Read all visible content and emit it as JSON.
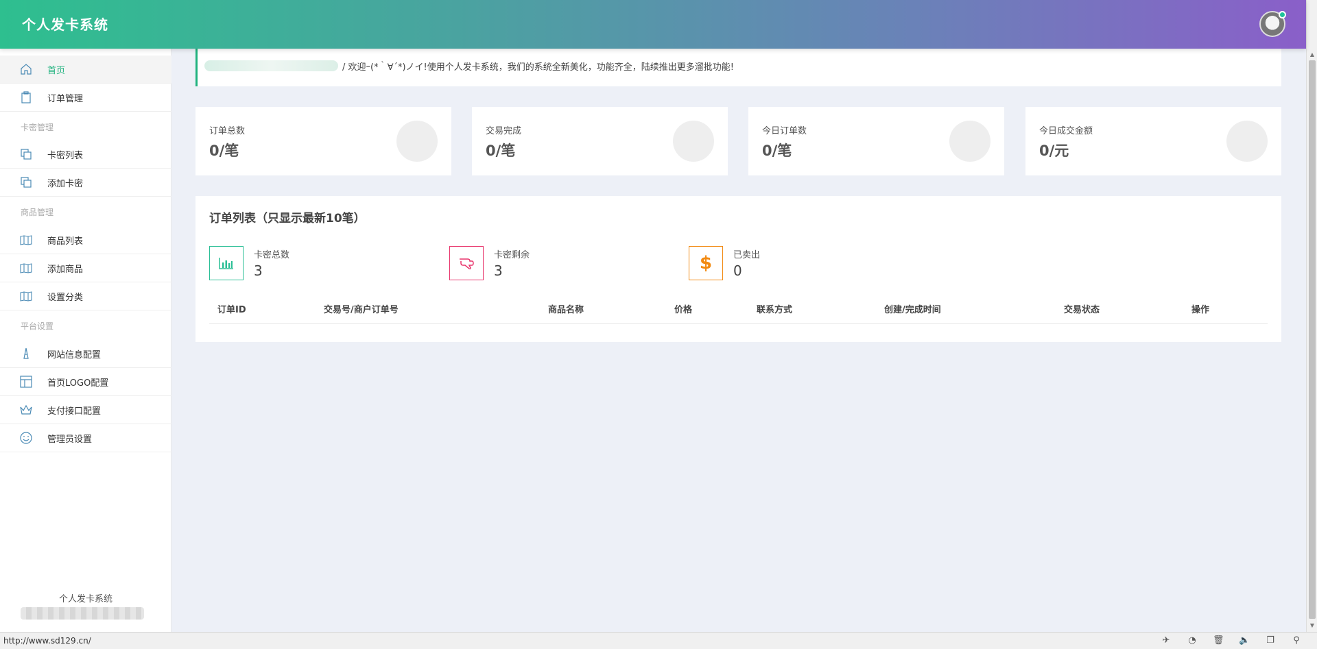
{
  "header": {
    "brand": "个人发卡系统"
  },
  "sidebar": {
    "items": [
      {
        "label": "首页",
        "icon": "home-icon"
      },
      {
        "label": "订单管理",
        "icon": "clipboard-icon"
      },
      {
        "group": "卡密管理"
      },
      {
        "label": "卡密列表",
        "icon": "copy-icon"
      },
      {
        "label": "添加卡密",
        "icon": "copy-icon"
      },
      {
        "group": "商品管理"
      },
      {
        "label": "商品列表",
        "icon": "book-icon"
      },
      {
        "label": "添加商品",
        "icon": "book-icon"
      },
      {
        "label": "设置分类",
        "icon": "book-icon"
      },
      {
        "group": "平台设置"
      },
      {
        "label": "网站信息配置",
        "icon": "tower-icon"
      },
      {
        "label": "首页LOGO配置",
        "icon": "layout-icon"
      },
      {
        "label": "支付接口配置",
        "icon": "crown-icon"
      },
      {
        "label": "管理员设置",
        "icon": "smile-icon"
      }
    ],
    "footer": "个人发卡系统"
  },
  "notice": {
    "text": "/  欢迎ｰ(*｀∀´*)ノイ!使用个人发卡系统，我们的系统全新美化，功能齐全，陆续推出更多溜批功能!"
  },
  "stats": [
    {
      "label": "订单总数",
      "value": "0/笔"
    },
    {
      "label": "交易完成",
      "value": "0/笔"
    },
    {
      "label": "今日订单数",
      "value": "0/笔"
    },
    {
      "label": "今日成交金额",
      "value": "0/元"
    }
  ],
  "orders": {
    "title": "订单列表（只显示最新10笔）",
    "summary": [
      {
        "label": "卡密总数",
        "value": "3",
        "icon": "bar-chart-icon",
        "color": "#2bbf96"
      },
      {
        "label": "卡密剩余",
        "value": "3",
        "icon": "hand-icon",
        "color": "#e8336b"
      },
      {
        "label": "已卖出",
        "value": "0",
        "icon": "dollar-icon",
        "color": "#f28a12"
      }
    ],
    "columns": [
      "订单ID",
      "交易号/商户订单号",
      "商品名称",
      "价格",
      "联系方式",
      "创建/完成时间",
      "交易状态",
      "操作"
    ]
  },
  "statusbar": {
    "url": "http://www.sd129.cn/"
  },
  "colors": {
    "accent": "#1fb27e",
    "gradient_start": "#2ebf8f",
    "gradient_end": "#8a5fc9"
  }
}
